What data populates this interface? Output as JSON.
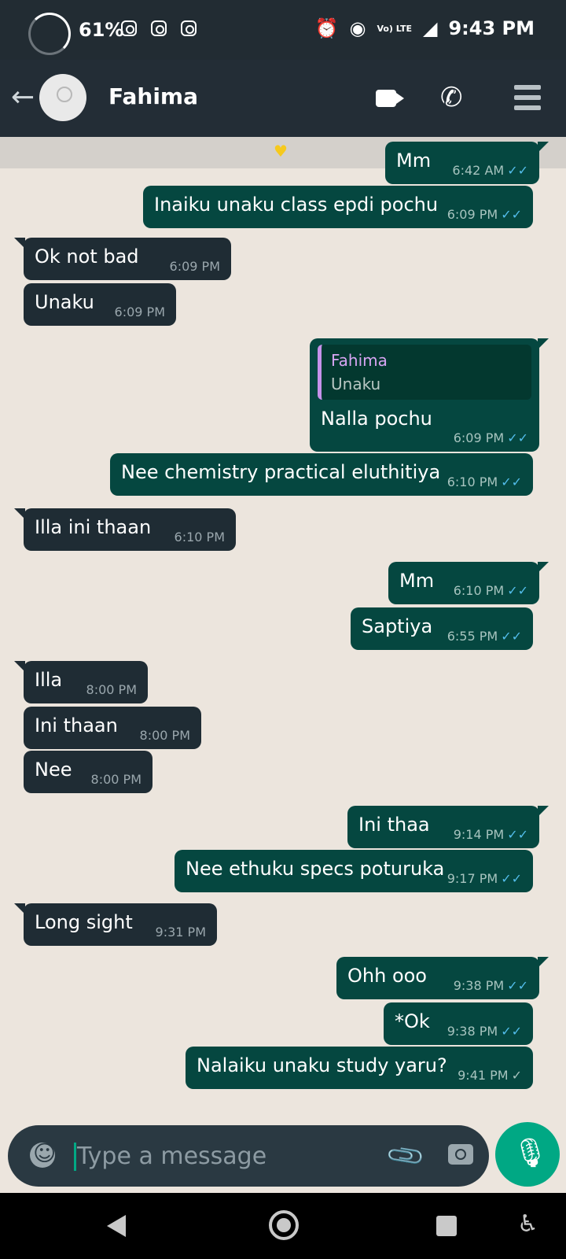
{
  "status_bar": {
    "battery": "61%",
    "network": "Vo) LTE",
    "lte": "LTE",
    "time": "9:43 PM"
  },
  "header": {
    "contact_name": "Fahima"
  },
  "chat": {
    "messages": [
      {
        "dir": "out",
        "text": "Mm",
        "time": "6:42 AM",
        "status": "read"
      },
      {
        "dir": "out",
        "text": "Inaiku unaku class epdi pochu",
        "time": "6:09 PM",
        "status": "read"
      },
      {
        "dir": "in",
        "text": "Ok not bad",
        "time": "6:09 PM"
      },
      {
        "dir": "in",
        "text": "Unaku",
        "time": "6:09 PM"
      },
      {
        "dir": "out",
        "quote_name": "Fahima",
        "quote_text": "Unaku",
        "text": "Nalla pochu",
        "time": "6:09 PM",
        "status": "read"
      },
      {
        "dir": "out",
        "text": "Nee chemistry practical eluthitiya",
        "time": "6:10 PM",
        "status": "read"
      },
      {
        "dir": "in",
        "text": "Illa ini thaan",
        "time": "6:10 PM"
      },
      {
        "dir": "out",
        "text": "Mm",
        "time": "6:10 PM",
        "status": "read"
      },
      {
        "dir": "out",
        "text": "Saptiya",
        "time": "6:55 PM",
        "status": "read"
      },
      {
        "dir": "in",
        "text": "Illa",
        "time": "8:00 PM"
      },
      {
        "dir": "in",
        "text": "Ini thaan",
        "time": "8:00 PM"
      },
      {
        "dir": "in",
        "text": "Nee",
        "time": "8:00 PM"
      },
      {
        "dir": "out",
        "text": "Ini thaa",
        "time": "9:14 PM",
        "status": "read"
      },
      {
        "dir": "out",
        "text": "Nee ethuku specs poturuka",
        "time": "9:17 PM",
        "status": "read"
      },
      {
        "dir": "in",
        "text": "Long sight",
        "time": "9:31 PM"
      },
      {
        "dir": "out",
        "text": "Ohh ooo",
        "time": "9:38 PM",
        "status": "read"
      },
      {
        "dir": "out",
        "text": "*Ok",
        "time": "9:38 PM",
        "status": "read"
      },
      {
        "dir": "out",
        "text": "Nalaiku unaku study yaru?",
        "time": "9:41 PM",
        "status": "sent"
      }
    ]
  },
  "input": {
    "placeholder": "Type a message"
  },
  "icons": [
    "back-arrow-icon",
    "video-call-icon",
    "voice-call-icon",
    "menu-icon",
    "emoji-icon",
    "attach-icon",
    "camera-icon",
    "mic-icon",
    "heart-icon"
  ],
  "colors": {
    "outgoing_bubble": "#054740",
    "incoming_bubble": "#1f2c34",
    "read_ticks": "#53bdeb",
    "accent": "#00a884"
  }
}
